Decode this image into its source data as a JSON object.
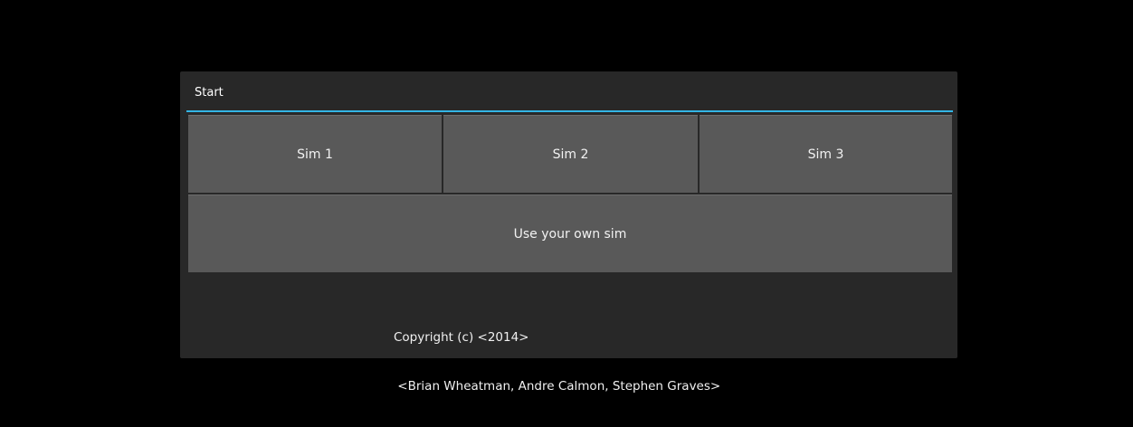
{
  "dialog": {
    "title": "Start",
    "buttons": {
      "sim1": "Sim 1",
      "sim2": "Sim 2",
      "sim3": "Sim 3",
      "own": "Use your own sim"
    },
    "copyright_line1": "Copyright (c) <2014>",
    "copyright_line2": " <Brian Wheatman, Andre Calmon, Stephen Graves>"
  },
  "colors": {
    "background": "#000000",
    "dialog": "#282828",
    "button": "#595959",
    "accent": "#33b5e5"
  }
}
